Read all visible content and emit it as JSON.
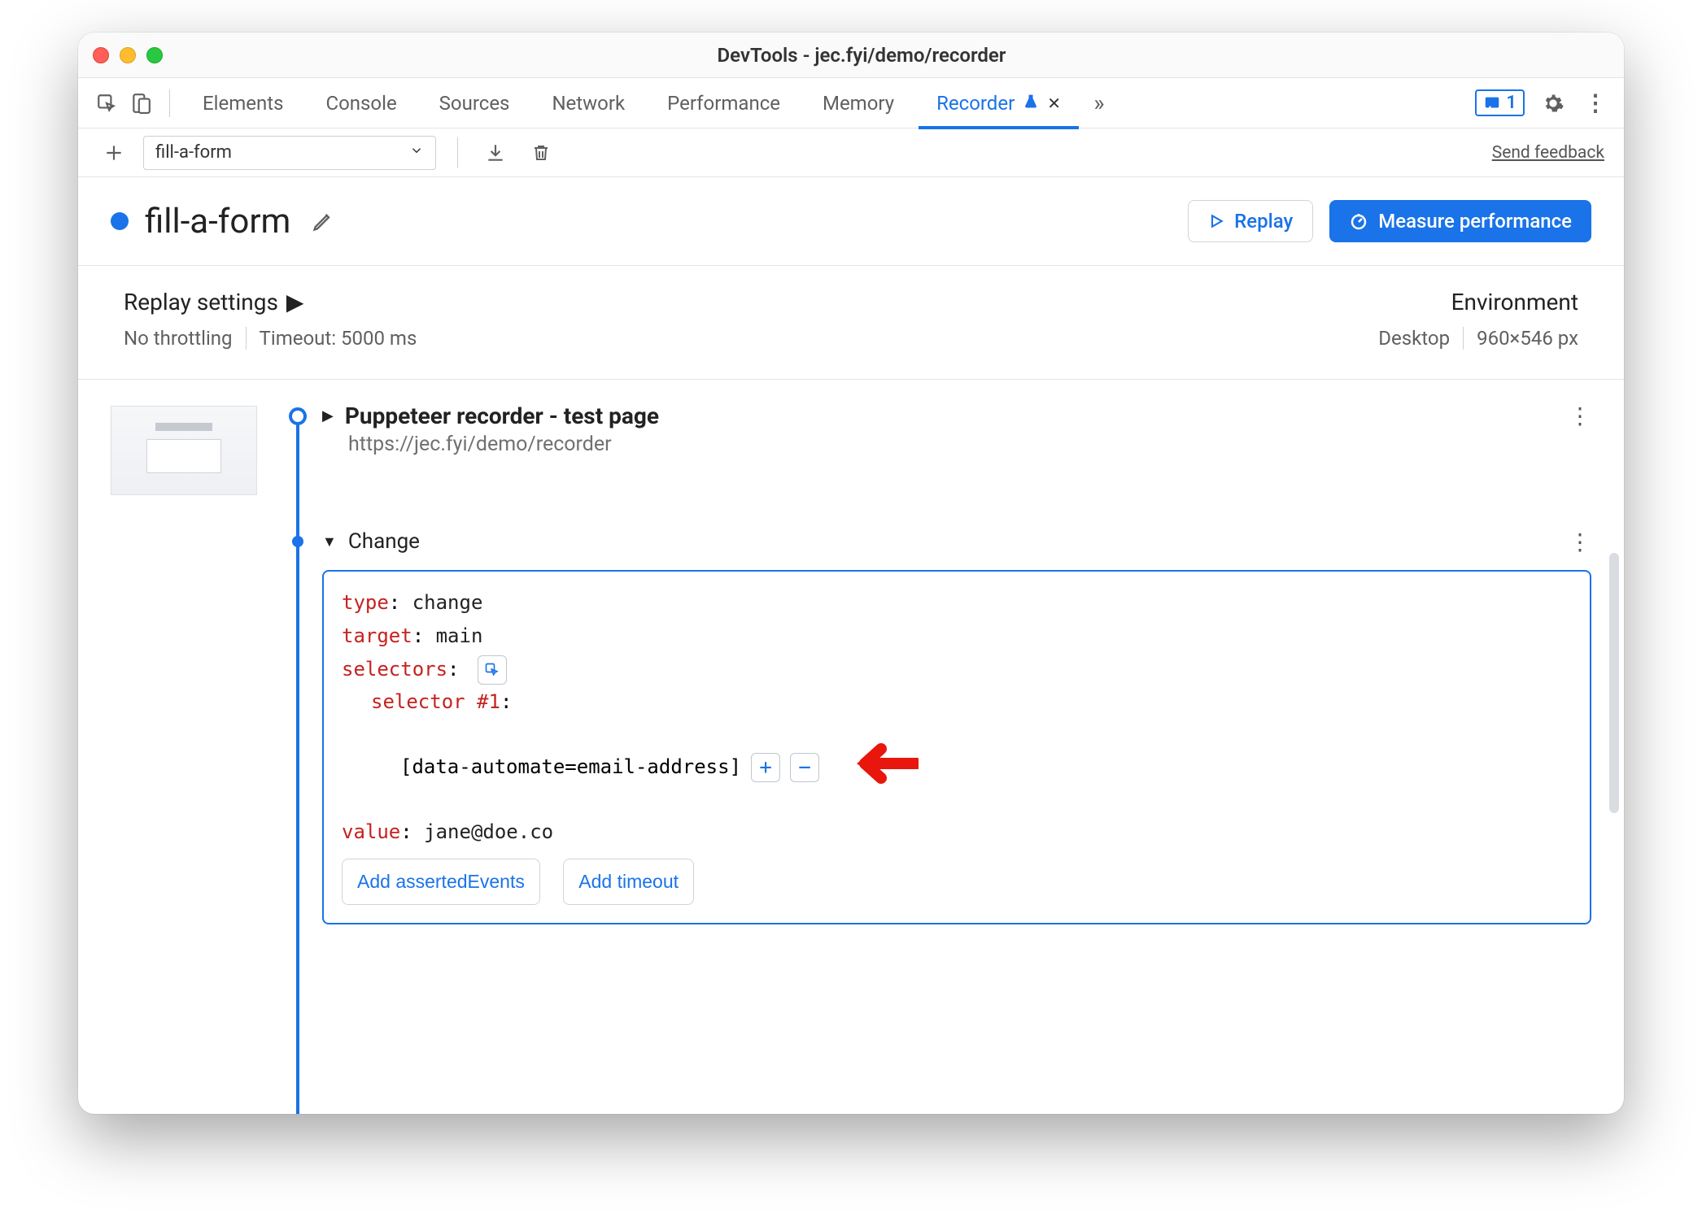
{
  "window": {
    "title": "DevTools - jec.fyi/demo/recorder"
  },
  "tabs": {
    "items": [
      "Elements",
      "Console",
      "Sources",
      "Network",
      "Performance",
      "Memory",
      "Recorder"
    ],
    "active": "Recorder",
    "issues_count": "1"
  },
  "subbar": {
    "recording_name": "fill-a-form",
    "feedback": "Send feedback"
  },
  "header": {
    "name": "fill-a-form",
    "replay": "Replay",
    "measure": "Measure performance"
  },
  "settings": {
    "replay_title": "Replay settings",
    "throttling": "No throttling",
    "timeout": "Timeout: 5000 ms",
    "env_title": "Environment",
    "device": "Desktop",
    "viewport": "960×546 px"
  },
  "steps": {
    "first": {
      "title": "Puppeteer recorder - test page",
      "url": "https://jec.fyi/demo/recorder"
    },
    "change": {
      "label": "Change",
      "fields": {
        "type_k": "type",
        "type_v": "change",
        "target_k": "target",
        "target_v": "main",
        "selectors_k": "selectors",
        "selector_num": "selector #1",
        "selector_val": "[data-automate=email-address]",
        "value_k": "value",
        "value_v": "jane@doe.co"
      },
      "add_asserted": "Add assertedEvents",
      "add_timeout": "Add timeout"
    }
  }
}
